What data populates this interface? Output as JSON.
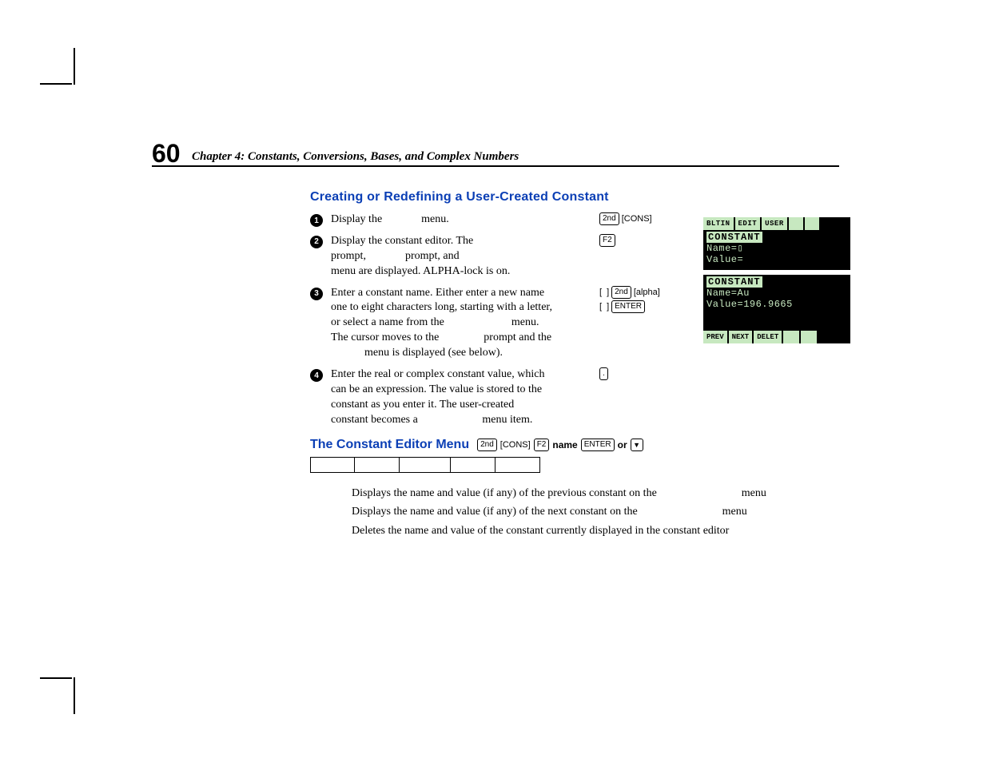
{
  "page_number": "60",
  "chapter_line": "Chapter 4:  Constants, Conversions, Bases, and Complex Numbers",
  "section_title": "Creating or Redefining a User-Created Constant",
  "steps": [
    {
      "n": "1",
      "text": "Display the              menu.",
      "keys": [
        [
          "2nd",
          "[CONS]"
        ]
      ]
    },
    {
      "n": "2",
      "text": "Display the constant editor. The\nprompt,              prompt, and\nmenu are displayed. ALPHA-lock is on.",
      "keys": [
        [
          "F2"
        ]
      ]
    },
    {
      "n": "3",
      "text": "Enter a constant name. Either enter a new name\none to eight characters long, starting with a letter,\nor select a name from the                        menu.\nThe cursor moves to the                prompt and the\n            menu is displayed (see below).",
      "keys": [
        [
          "[",
          " ",
          "]",
          "2nd",
          "[alpha]"
        ],
        [
          "[",
          " ",
          "]",
          "ENTER"
        ]
      ]
    },
    {
      "n": "4",
      "text": "Enter the real or complex constant value, which\ncan be an expression. The value is stored to the\nconstant as you enter it. The user-created\nconstant becomes a                       menu item.",
      "keys": [
        [
          "."
        ]
      ]
    }
  ],
  "second_title": "The Constant Editor Menu",
  "second_keys": {
    "k1": "2nd",
    "k2": "[CONS]",
    "k3": "F2",
    "name": "name",
    "k4": "ENTER",
    "or": "or",
    "arrow": "▼"
  },
  "desc": [
    {
      "body": "Displays the name and value (if any) of the previous constant on the",
      "tail": "menu"
    },
    {
      "body": "Displays the name and value (if any) of the next constant on the",
      "tail": "menu"
    },
    {
      "body": "Deletes the name and value of the constant currently displayed in the constant editor",
      "tail": ""
    }
  ],
  "lcd1": {
    "menu": [
      "BLTIN",
      "EDIT",
      "USER"
    ],
    "title": "CONSTANT",
    "l1": "Name=▯",
    "l2": "Value="
  },
  "lcd2": {
    "title": "CONSTANT",
    "l1": "Name=Au",
    "l2": "Value=196.9665",
    "menu": [
      "PREV",
      "NEXT",
      "DELET"
    ]
  }
}
